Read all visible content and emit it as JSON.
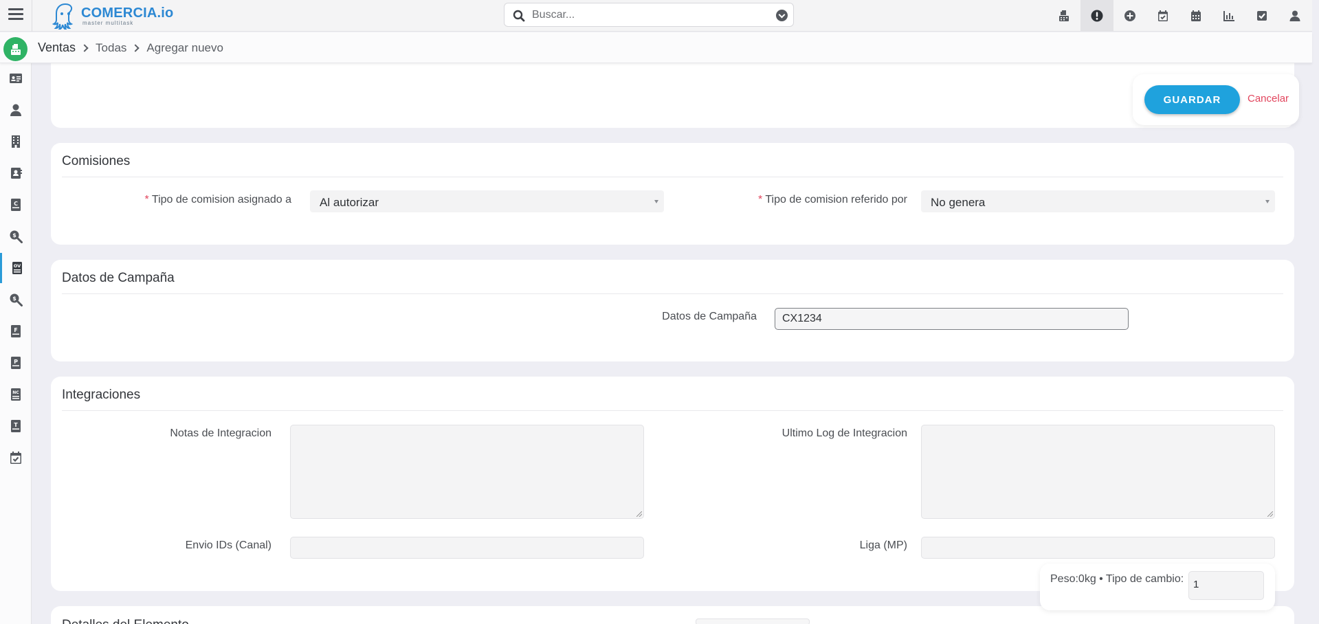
{
  "app": {
    "brand_name": "COMERCIA.io",
    "brand_tagline": "master multitask"
  },
  "search": {
    "placeholder": "Buscar..."
  },
  "top_icons": [
    "cash-register-icon",
    "alert-icon",
    "plus-circle-icon",
    "calendar-check-icon",
    "calendar-icon",
    "bar-chart-icon",
    "checkbox-icon",
    "user-icon"
  ],
  "breadcrumb": {
    "items": [
      "Ventas",
      "Todas",
      "Agregar nuevo"
    ]
  },
  "sidebar": {
    "icons": [
      "id-card-icon",
      "user-icon",
      "building-icon",
      "contact-book-icon",
      "document-c-icon",
      "search-dollar-icon",
      "document-ov-icon",
      "search-money-icon",
      "document-f-icon",
      "document-p-icon",
      "document-nc-icon",
      "document-t-icon",
      "calendar-check-icon"
    ],
    "active_index": 6
  },
  "actions": {
    "save_label": "GUARDAR",
    "cancel_label": "Cancelar"
  },
  "comisiones": {
    "title": "Comisiones",
    "asignado_label": "Tipo de comision asignado a",
    "asignado_value": "Al autorizar",
    "referido_label": "Tipo de comision referido por",
    "referido_value": "No genera",
    "required_mark": "*"
  },
  "campana": {
    "title": "Datos de Campaña",
    "field_label": "Datos de Campaña",
    "field_value": "CX1234"
  },
  "integraciones": {
    "title": "Integraciones",
    "notas_label": "Notas de Integracion",
    "notas_value": "",
    "log_label": "Ultimo Log de Integracion",
    "log_value": "",
    "envio_label": "Envio IDs (Canal)",
    "envio_value": "",
    "liga_label": "Liga (MP)",
    "liga_value": ""
  },
  "summary": {
    "text": "Peso:0kg • Tipo de cambio:",
    "tipo_cambio_value": "1"
  },
  "next_section": {
    "title": "Detalles del Elemento"
  },
  "colors": {
    "accent": "#1fa2dd",
    "cancel": "#e2455d",
    "badge": "#2fb365",
    "brand": "#2c88d3"
  }
}
